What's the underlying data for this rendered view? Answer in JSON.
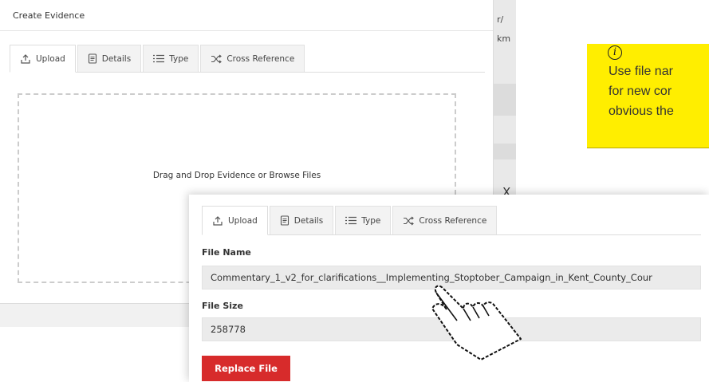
{
  "background_modal": {
    "title": "Create Evidence",
    "tabs": [
      {
        "label": "Upload",
        "icon": "upload-icon",
        "active": true
      },
      {
        "label": "Details",
        "icon": "document-icon",
        "active": false
      },
      {
        "label": "Type",
        "icon": "list-icon",
        "active": false
      },
      {
        "label": "Cross Reference",
        "icon": "shuffle-icon",
        "active": false
      }
    ],
    "dropzone_text": "Drag and Drop Evidence or Browse Files",
    "edge_fragments": [
      "r/",
      "km",
      "X"
    ]
  },
  "upload_panel": {
    "tabs": [
      {
        "label": "Upload",
        "icon": "upload-icon",
        "active": true
      },
      {
        "label": "Details",
        "icon": "document-icon",
        "active": false
      },
      {
        "label": "Type",
        "icon": "list-icon",
        "active": false
      },
      {
        "label": "Cross Reference",
        "icon": "shuffle-icon",
        "active": false
      }
    ],
    "file_name_label": "File Name",
    "file_name_value": "Commentary_1_v2_for_clarifications__Implementing_Stoptober_Campaign_in_Kent_County_Cour",
    "file_size_label": "File Size",
    "file_size_value": "258778",
    "replace_button": "Replace File"
  },
  "callout": {
    "icon": "info-icon",
    "icon_glyph": "i",
    "lines": [
      "Use file nar",
      "for new cor",
      "obvious the"
    ]
  },
  "colors": {
    "callout_bg": "#ffee00",
    "replace_button": "#d72b2b"
  }
}
